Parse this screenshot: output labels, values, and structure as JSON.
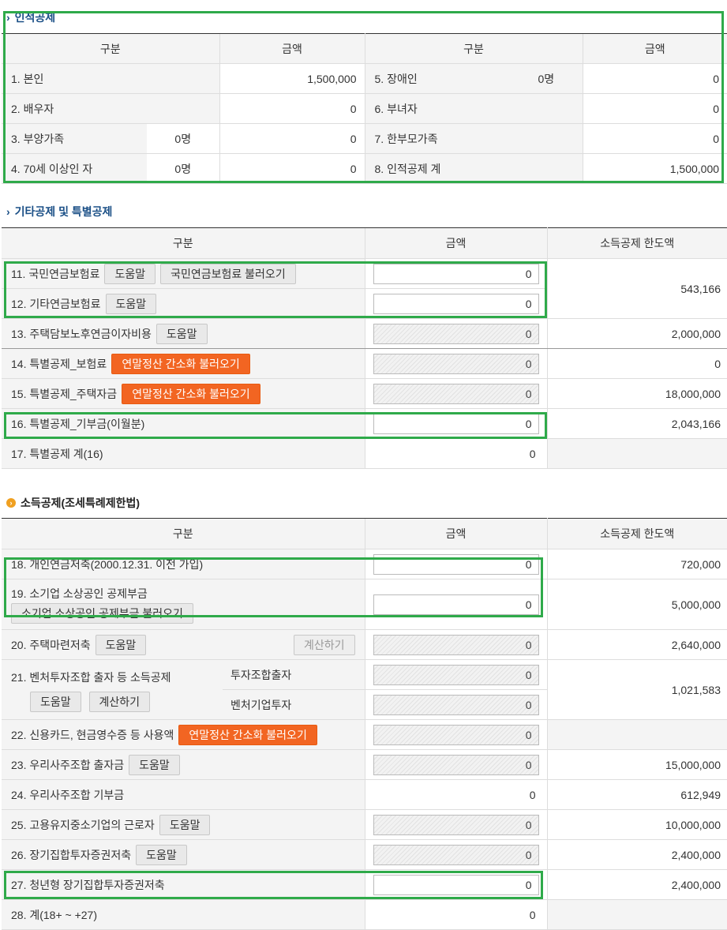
{
  "section1": {
    "title": "인적공제",
    "headers": [
      "구분",
      "금액",
      "구분",
      "금액"
    ],
    "rows": [
      {
        "label": "1. 본인",
        "count": "",
        "amount": "1,500,000",
        "label2": "5. 장애인",
        "count2": "0명",
        "amount2": "0"
      },
      {
        "label": "2. 배우자",
        "count": "",
        "amount": "0",
        "label2": "6. 부녀자",
        "count2": "",
        "amount2": "0"
      },
      {
        "label": "3. 부양가족",
        "count": "0명",
        "amount": "0",
        "label2": "7. 한부모가족",
        "count2": "",
        "amount2": "0"
      },
      {
        "label": "4. 70세 이상인 자",
        "count": "0명",
        "amount": "0",
        "label2": "8. 인적공제 계",
        "count2": "",
        "amount2": "1,500,000"
      }
    ]
  },
  "section2": {
    "title": "기타공제 및 특별공제",
    "headers": [
      "구분",
      "금액",
      "소득공제 한도액"
    ],
    "r11": {
      "label": "11. 국민연금보험료",
      "help": "도움말",
      "load": "국민연금보험료 불러오기",
      "value": "0"
    },
    "r12": {
      "label": "12. 기타연금보험료",
      "help": "도움말",
      "value": "0"
    },
    "limit_11_12": "543,166",
    "r13": {
      "label": "13. 주택담보노후연금이자비용",
      "help": "도움말",
      "value": "0",
      "limit": "2,000,000"
    },
    "r14": {
      "label": "14. 특별공제_보험료",
      "load": "연말정산 간소화 불러오기",
      "value": "0",
      "limit": "0"
    },
    "r15": {
      "label": "15. 특별공제_주택자금",
      "load": "연말정산 간소화 불러오기",
      "value": "0",
      "limit": "18,000,000"
    },
    "r16": {
      "label": "16. 특별공제_기부금(이월분)",
      "value": "0",
      "limit": "2,043,166"
    },
    "r17": {
      "label": "17. 특별공제 계(16)",
      "value": "0"
    }
  },
  "section3": {
    "title": "소득공제(조세특례제한법)",
    "headers": [
      "구분",
      "금액",
      "소득공제 한도액"
    ],
    "r18": {
      "label": "18. 개인연금저축(2000.12.31. 이전 가입)",
      "value": "0",
      "limit": "720,000"
    },
    "r19": {
      "label": "19. 소기업 소상공인 공제부금",
      "load": "소기업 소상공인 공제부금 불러오기",
      "value": "0",
      "limit": "5,000,000"
    },
    "r20": {
      "label": "20. 주택마련저축",
      "help": "도움말",
      "calc": "계산하기",
      "value": "0",
      "limit": "2,640,000"
    },
    "r21": {
      "label": "21. 벤처투자조합 출자 등 소득공제",
      "help": "도움말",
      "calc": "계산하기",
      "sub1": "투자조합출자",
      "sub2": "벤처기업투자",
      "value1": "0",
      "value2": "0",
      "limit": "1,021,583"
    },
    "r22": {
      "label": "22. 신용카드, 현금영수증 등 사용액",
      "load": "연말정산 간소화 불러오기",
      "value": "0"
    },
    "r23": {
      "label": "23. 우리사주조합 출자금",
      "help": "도움말",
      "value": "0",
      "limit": "15,000,000"
    },
    "r24": {
      "label": "24. 우리사주조합 기부금",
      "value": "0",
      "limit": "612,949"
    },
    "r25": {
      "label": "25. 고용유지중소기업의 근로자",
      "help": "도움말",
      "value": "0",
      "limit": "10,000,000"
    },
    "r26": {
      "label": "26. 장기집합투자증권저축",
      "help": "도움말",
      "value": "0",
      "limit": "2,400,000"
    },
    "r27": {
      "label": "27. 청년형 장기집합투자증권저축",
      "value": "0",
      "limit": "2,400,000"
    },
    "r28": {
      "label": "28. 계(18+ ~ +27)",
      "value": "0"
    }
  },
  "colors": {
    "highlight": "#2faa4a",
    "orange_button": "#f26522",
    "title_blue": "#1a4f86"
  }
}
